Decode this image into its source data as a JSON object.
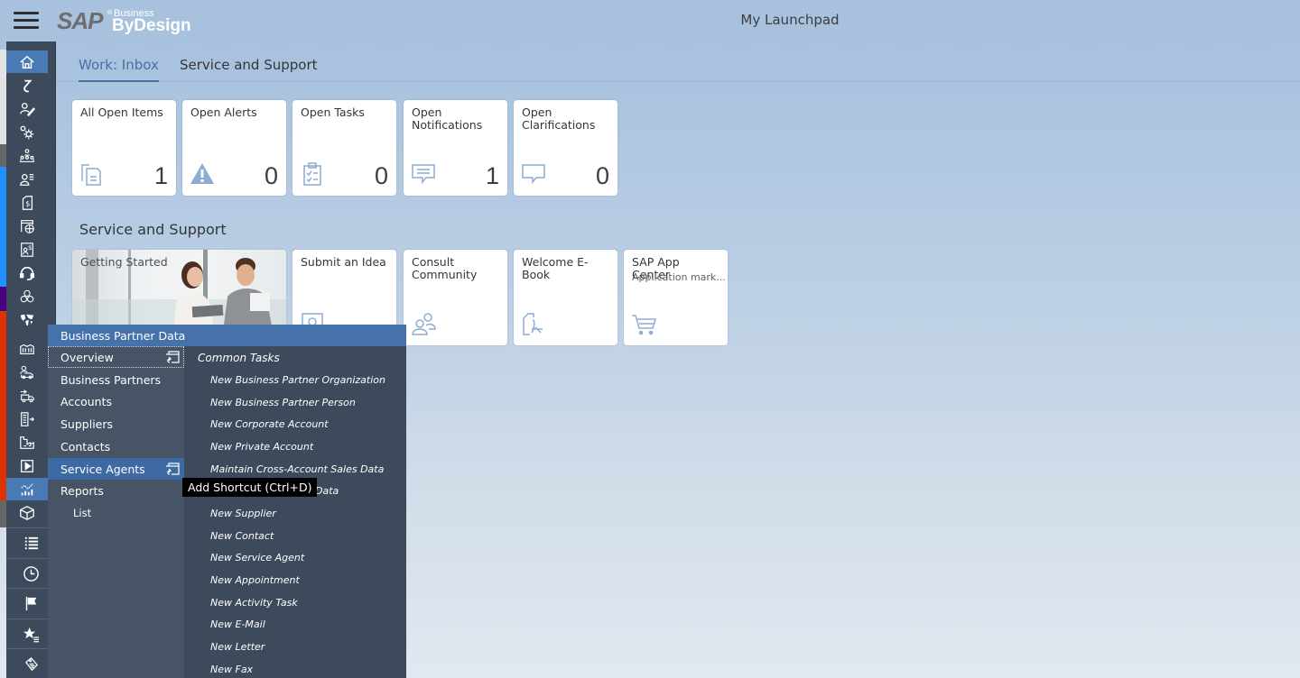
{
  "header": {
    "menu_icon": "hamburger-icon",
    "logo": {
      "sap": "SAP",
      "registered": "®",
      "business": "Business",
      "bydesign": "ByDesign"
    },
    "title": "My Launchpad"
  },
  "left_strip_colors": [
    "#e3e3e3",
    "#666666",
    "#1e90ff",
    "#4b0082",
    "#dd3300",
    "#666666"
  ],
  "sidebar": {
    "items": [
      {
        "icon": "home-icon",
        "active": true
      },
      {
        "icon": "refresh-arrow-icon"
      },
      {
        "icon": "user-edit-icon"
      },
      {
        "icon": "gears-icon"
      },
      {
        "icon": "org-hierarchy-icon"
      },
      {
        "icon": "user-list-icon"
      },
      {
        "icon": "invoice-dollar-icon"
      },
      {
        "icon": "calendar-globe-icon"
      },
      {
        "icon": "employee-dollar-icon"
      },
      {
        "icon": "headset-icon"
      },
      {
        "icon": "cubes-icon"
      },
      {
        "icon": "map-icon"
      },
      {
        "icon": "factory-icon"
      },
      {
        "icon": "person-truck-icon"
      },
      {
        "icon": "delivery-truck-icon"
      },
      {
        "icon": "building-arrow-icon"
      },
      {
        "icon": "production-icon"
      },
      {
        "icon": "play-icon"
      },
      {
        "icon": "analytics-icon",
        "active": true
      },
      {
        "icon": "box-icon"
      }
    ],
    "bottom": [
      {
        "icon": "list-icon"
      },
      {
        "icon": "clock-icon"
      },
      {
        "icon": "flag-icon"
      },
      {
        "icon": "favorites-icon"
      },
      {
        "icon": "tag-icon"
      }
    ]
  },
  "tabs": [
    {
      "label": "Work: Inbox",
      "active": true
    },
    {
      "label": "Service and Support",
      "active": false
    }
  ],
  "inbox_tiles": [
    {
      "title": "All Open Items",
      "count": "1",
      "icon": "documents-icon"
    },
    {
      "title": "Open Alerts",
      "count": "0",
      "icon": "alert-icon"
    },
    {
      "title": "Open Tasks",
      "count": "0",
      "icon": "task-clipboard-icon"
    },
    {
      "title": "Open Notifications",
      "count": "1",
      "icon": "message-icon"
    },
    {
      "title": "Open Clarifications",
      "count": "0",
      "icon": "comment-icon"
    }
  ],
  "service_section": {
    "title": "Service and Support",
    "tiles": [
      {
        "title": "Getting Started",
        "type": "photo"
      },
      {
        "title": "Submit an Idea",
        "icon": "idea-icon"
      },
      {
        "title": "Consult Community",
        "icon": "group-icon"
      },
      {
        "title": "Welcome E-Book",
        "icon": "pdf-icon"
      },
      {
        "title": "SAP App Center",
        "subtitle": "Application mark...",
        "icon": "cart-icon"
      }
    ]
  },
  "flyout": {
    "header": "Business Partner Data",
    "left_items": [
      {
        "label": "Overview",
        "focused": true,
        "shortcut": true
      },
      {
        "label": "Business Partners"
      },
      {
        "label": "Accounts"
      },
      {
        "label": "Suppliers"
      },
      {
        "label": "Contacts"
      },
      {
        "label": "Service Agents",
        "selected": true,
        "shortcut": true
      },
      {
        "label": "Reports"
      },
      {
        "label": "List",
        "sub": true
      }
    ],
    "right_heading": "Common Tasks",
    "right_items": [
      "New Business Partner Organization",
      "New Business Partner Person",
      "New Corporate Account",
      "New Private Account",
      "Maintain Cross-Account Sales Data",
      "Data",
      "New Supplier",
      "New Contact",
      "New Service Agent",
      "New Appointment",
      "New Activity Task",
      "New E-Mail",
      "New Letter",
      "New Fax"
    ]
  },
  "tooltip": "Add Shortcut (Ctrl+D)"
}
